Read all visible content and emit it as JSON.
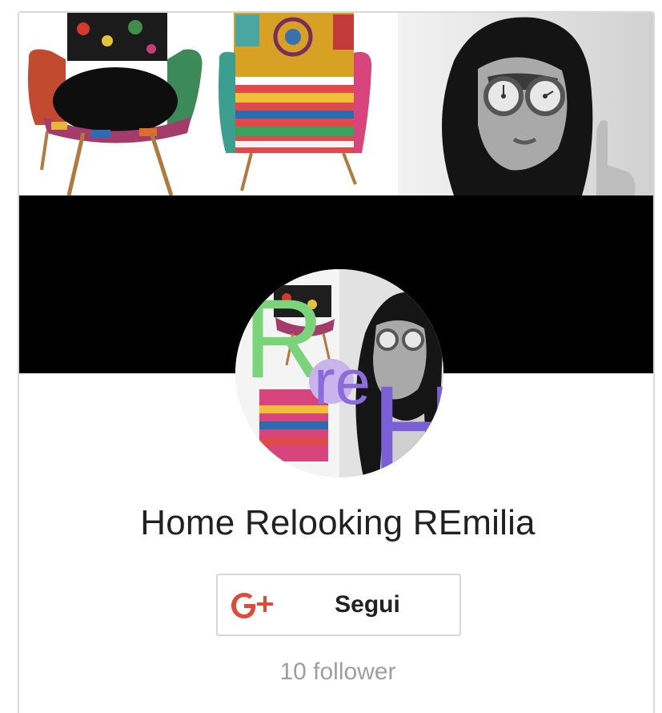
{
  "profile": {
    "name": "Home Relooking REmilia",
    "follow_label": "Segui",
    "followers": "10 follower"
  },
  "cover": {
    "left_photo": "patterned-armchairs",
    "right_photo": "woman-with-clock-glasses",
    "band_color": "#000000"
  },
  "avatar": {
    "letters": {
      "r": "R",
      "re": "re",
      "h": "H"
    },
    "colors": {
      "r": "#7bd37a",
      "re": "#b89be6",
      "h": "#7a5fd6"
    }
  },
  "icons": {
    "follow": "google-plus-icon"
  },
  "colors": {
    "google_red": "#dd4b39",
    "text": "#212121",
    "muted": "#9e9e9e",
    "border": "#d6d6d6"
  }
}
